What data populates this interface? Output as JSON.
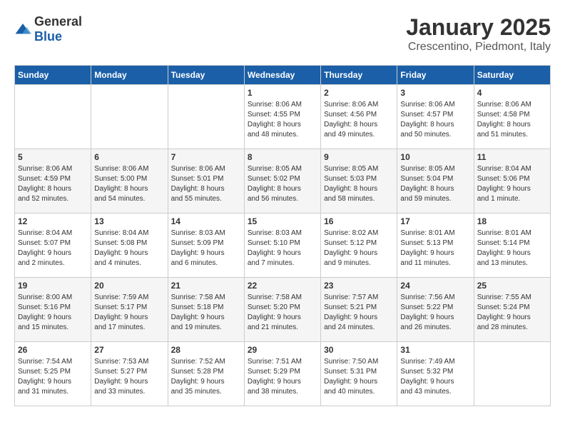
{
  "header": {
    "logo": {
      "general": "General",
      "blue": "Blue"
    },
    "month": "January 2025",
    "location": "Crescentino, Piedmont, Italy"
  },
  "days_of_week": [
    "Sunday",
    "Monday",
    "Tuesday",
    "Wednesday",
    "Thursday",
    "Friday",
    "Saturday"
  ],
  "weeks": [
    [
      {
        "day": "",
        "info": ""
      },
      {
        "day": "",
        "info": ""
      },
      {
        "day": "",
        "info": ""
      },
      {
        "day": "1",
        "info": "Sunrise: 8:06 AM\nSunset: 4:55 PM\nDaylight: 8 hours\nand 48 minutes."
      },
      {
        "day": "2",
        "info": "Sunrise: 8:06 AM\nSunset: 4:56 PM\nDaylight: 8 hours\nand 49 minutes."
      },
      {
        "day": "3",
        "info": "Sunrise: 8:06 AM\nSunset: 4:57 PM\nDaylight: 8 hours\nand 50 minutes."
      },
      {
        "day": "4",
        "info": "Sunrise: 8:06 AM\nSunset: 4:58 PM\nDaylight: 8 hours\nand 51 minutes."
      }
    ],
    [
      {
        "day": "5",
        "info": "Sunrise: 8:06 AM\nSunset: 4:59 PM\nDaylight: 8 hours\nand 52 minutes."
      },
      {
        "day": "6",
        "info": "Sunrise: 8:06 AM\nSunset: 5:00 PM\nDaylight: 8 hours\nand 54 minutes."
      },
      {
        "day": "7",
        "info": "Sunrise: 8:06 AM\nSunset: 5:01 PM\nDaylight: 8 hours\nand 55 minutes."
      },
      {
        "day": "8",
        "info": "Sunrise: 8:05 AM\nSunset: 5:02 PM\nDaylight: 8 hours\nand 56 minutes."
      },
      {
        "day": "9",
        "info": "Sunrise: 8:05 AM\nSunset: 5:03 PM\nDaylight: 8 hours\nand 58 minutes."
      },
      {
        "day": "10",
        "info": "Sunrise: 8:05 AM\nSunset: 5:04 PM\nDaylight: 8 hours\nand 59 minutes."
      },
      {
        "day": "11",
        "info": "Sunrise: 8:04 AM\nSunset: 5:06 PM\nDaylight: 9 hours\nand 1 minute."
      }
    ],
    [
      {
        "day": "12",
        "info": "Sunrise: 8:04 AM\nSunset: 5:07 PM\nDaylight: 9 hours\nand 2 minutes."
      },
      {
        "day": "13",
        "info": "Sunrise: 8:04 AM\nSunset: 5:08 PM\nDaylight: 9 hours\nand 4 minutes."
      },
      {
        "day": "14",
        "info": "Sunrise: 8:03 AM\nSunset: 5:09 PM\nDaylight: 9 hours\nand 6 minutes."
      },
      {
        "day": "15",
        "info": "Sunrise: 8:03 AM\nSunset: 5:10 PM\nDaylight: 9 hours\nand 7 minutes."
      },
      {
        "day": "16",
        "info": "Sunrise: 8:02 AM\nSunset: 5:12 PM\nDaylight: 9 hours\nand 9 minutes."
      },
      {
        "day": "17",
        "info": "Sunrise: 8:01 AM\nSunset: 5:13 PM\nDaylight: 9 hours\nand 11 minutes."
      },
      {
        "day": "18",
        "info": "Sunrise: 8:01 AM\nSunset: 5:14 PM\nDaylight: 9 hours\nand 13 minutes."
      }
    ],
    [
      {
        "day": "19",
        "info": "Sunrise: 8:00 AM\nSunset: 5:16 PM\nDaylight: 9 hours\nand 15 minutes."
      },
      {
        "day": "20",
        "info": "Sunrise: 7:59 AM\nSunset: 5:17 PM\nDaylight: 9 hours\nand 17 minutes."
      },
      {
        "day": "21",
        "info": "Sunrise: 7:58 AM\nSunset: 5:18 PM\nDaylight: 9 hours\nand 19 minutes."
      },
      {
        "day": "22",
        "info": "Sunrise: 7:58 AM\nSunset: 5:20 PM\nDaylight: 9 hours\nand 21 minutes."
      },
      {
        "day": "23",
        "info": "Sunrise: 7:57 AM\nSunset: 5:21 PM\nDaylight: 9 hours\nand 24 minutes."
      },
      {
        "day": "24",
        "info": "Sunrise: 7:56 AM\nSunset: 5:22 PM\nDaylight: 9 hours\nand 26 minutes."
      },
      {
        "day": "25",
        "info": "Sunrise: 7:55 AM\nSunset: 5:24 PM\nDaylight: 9 hours\nand 28 minutes."
      }
    ],
    [
      {
        "day": "26",
        "info": "Sunrise: 7:54 AM\nSunset: 5:25 PM\nDaylight: 9 hours\nand 31 minutes."
      },
      {
        "day": "27",
        "info": "Sunrise: 7:53 AM\nSunset: 5:27 PM\nDaylight: 9 hours\nand 33 minutes."
      },
      {
        "day": "28",
        "info": "Sunrise: 7:52 AM\nSunset: 5:28 PM\nDaylight: 9 hours\nand 35 minutes."
      },
      {
        "day": "29",
        "info": "Sunrise: 7:51 AM\nSunset: 5:29 PM\nDaylight: 9 hours\nand 38 minutes."
      },
      {
        "day": "30",
        "info": "Sunrise: 7:50 AM\nSunset: 5:31 PM\nDaylight: 9 hours\nand 40 minutes."
      },
      {
        "day": "31",
        "info": "Sunrise: 7:49 AM\nSunset: 5:32 PM\nDaylight: 9 hours\nand 43 minutes."
      },
      {
        "day": "",
        "info": ""
      }
    ]
  ]
}
